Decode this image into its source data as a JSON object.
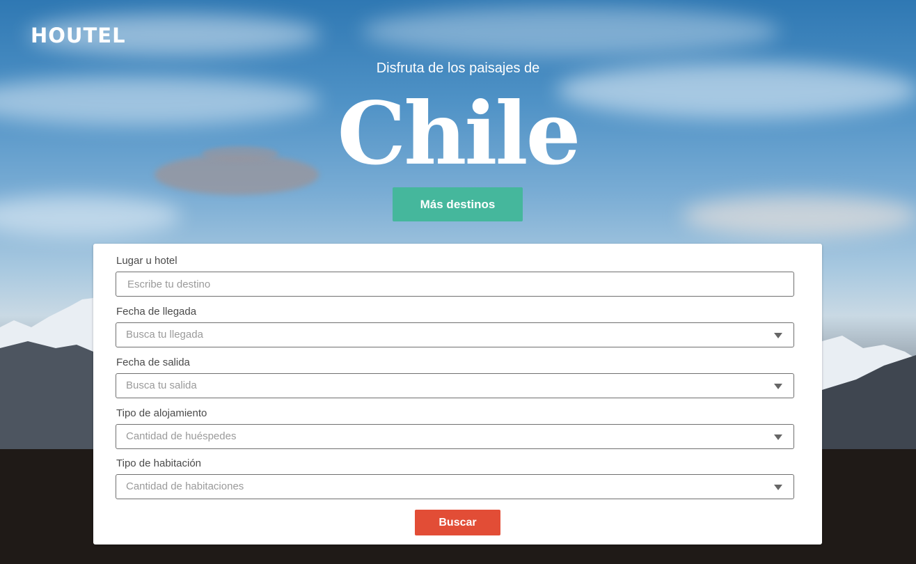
{
  "brand": {
    "name": "HOUTEL"
  },
  "hero": {
    "subtitle": "Disfruta de los paisajes de",
    "headline": "Chile",
    "more_button": "Más destinos"
  },
  "form": {
    "fields": [
      {
        "label": "Lugar u hotel",
        "placeholder": "Escribe tu destino",
        "kind": "text"
      },
      {
        "label": "Fecha de llegada",
        "placeholder": "Busca tu llegada",
        "kind": "select"
      },
      {
        "label": "Fecha de salida",
        "placeholder": "Busca tu salida",
        "kind": "select"
      },
      {
        "label": "Tipo de alojamiento",
        "placeholder": "Cantidad de huéspedes",
        "kind": "select"
      },
      {
        "label": "Tipo de habitación",
        "placeholder": "Cantidad de habitaciones",
        "kind": "select"
      }
    ],
    "submit_label": "Buscar"
  },
  "colors": {
    "accent_green": "#45b79c",
    "accent_red": "#e24d36",
    "sky_blue": "#2f78b3"
  },
  "icons": {
    "select_caret": "chevron-down-icon"
  }
}
